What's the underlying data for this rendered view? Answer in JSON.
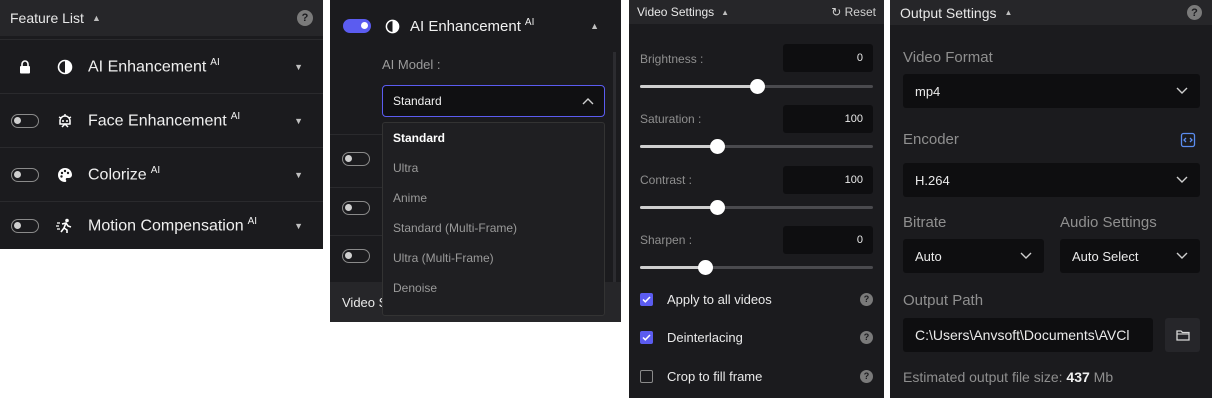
{
  "feature_list": {
    "title": "Feature List",
    "items": [
      {
        "label": "AI Enhancement",
        "badge": "AI",
        "icon": "half-circle-icon",
        "state": "locked"
      },
      {
        "label": "Face Enhancement",
        "badge": "AI",
        "icon": "face-icon",
        "state": "off"
      },
      {
        "label": "Colorize",
        "badge": "AI",
        "icon": "palette-icon",
        "state": "off"
      },
      {
        "label": "Motion Compensation",
        "badge": "AI",
        "icon": "running-icon",
        "state": "off"
      }
    ]
  },
  "ai_enhancement_panel": {
    "title": "AI Enhancement",
    "badge": "AI",
    "model_label": "AI Model :",
    "selected_model": "Standard",
    "options": [
      "Standard",
      "Ultra",
      "Anime",
      "Standard (Multi-Frame)",
      "Ultra (Multi-Frame)",
      "Denoise"
    ],
    "bottom_label": "Video S"
  },
  "video_settings": {
    "title": "Video Settings",
    "reset_label": "Reset",
    "sliders": [
      {
        "label": "Brightness :",
        "value": "0",
        "fraction": 0.5
      },
      {
        "label": "Saturation :",
        "value": "100",
        "fraction": 0.33
      },
      {
        "label": "Contrast :",
        "value": "100",
        "fraction": 0.33
      },
      {
        "label": "Sharpen :",
        "value": "0",
        "fraction": 0.28
      }
    ],
    "checkboxes": [
      {
        "label": "Apply to all videos",
        "checked": true
      },
      {
        "label": "Deinterlacing",
        "checked": true
      },
      {
        "label": "Crop to fill frame",
        "checked": false
      }
    ]
  },
  "output_settings": {
    "title": "Output Settings",
    "video_format_label": "Video Format",
    "video_format_value": "mp4",
    "encoder_label": "Encoder",
    "encoder_value": "H.264",
    "bitrate_label": "Bitrate",
    "bitrate_value": "Auto",
    "audio_label": "Audio Settings",
    "audio_value": "Auto Select",
    "output_path_label": "Output Path",
    "output_path_value": "C:\\Users\\Anvsoft\\Documents\\AVCl",
    "estimate_prefix": "Estimated output file size:",
    "estimate_value": "437",
    "estimate_unit": "Mb"
  },
  "colors": {
    "accent": "#5b5cf0",
    "panel_bg": "#1b1b1e",
    "header_bg": "#262629",
    "field_bg": "#0e0e10"
  }
}
